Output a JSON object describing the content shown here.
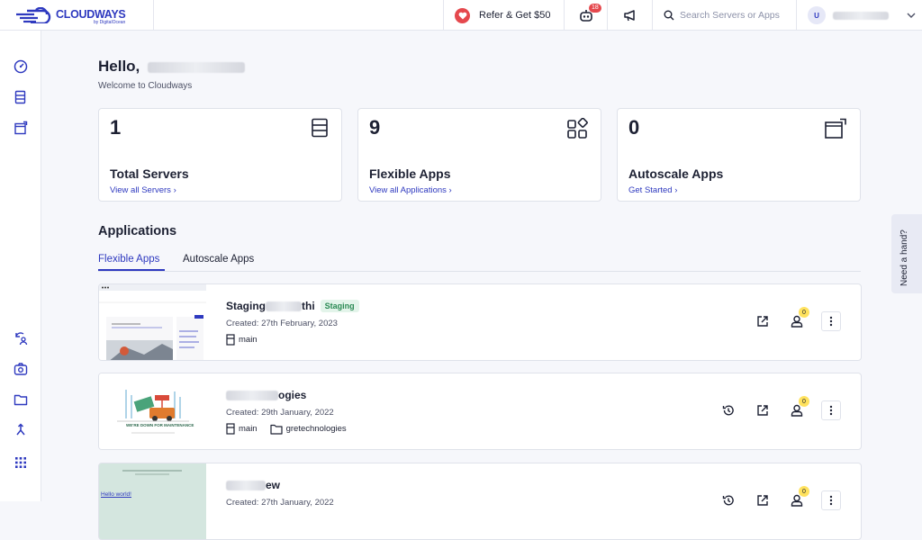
{
  "brand": {
    "name": "CLOUDWAYS",
    "sub": "by DigitalOcean"
  },
  "topbar": {
    "refer_label": "Refer & Get $50",
    "notif_count": "18",
    "search_placeholder": "Search Servers or Apps",
    "user_initial": "U"
  },
  "greeting": {
    "hello": "Hello,",
    "welcome": "Welcome to Cloudways"
  },
  "cards": [
    {
      "number": "1",
      "title": "Total Servers",
      "link": "View all Servers ›"
    },
    {
      "number": "9",
      "title": "Flexible Apps",
      "link": "View all Applications ›"
    },
    {
      "number": "0",
      "title": "Autoscale Apps",
      "link": "Get Started ›"
    }
  ],
  "applications": {
    "heading": "Applications",
    "tabs": [
      {
        "label": "Flexible Apps"
      },
      {
        "label": "Autoscale Apps"
      }
    ],
    "rows": [
      {
        "name_a": "Staging",
        "name_b": "thi",
        "tag": "Staging",
        "created": "Created: 27th February, 2023",
        "branch": "main",
        "folder": "",
        "collab": "0"
      },
      {
        "name_a": "",
        "name_b": "ogies",
        "tag": "",
        "created": "Created: 29th January, 2022",
        "branch": "main",
        "folder": "gretechnologies",
        "collab": "0"
      },
      {
        "name_a": "",
        "name_b": "ew",
        "tag": "",
        "created": "Created: 27th January, 2022",
        "branch": "",
        "folder": "",
        "collab": "0"
      }
    ]
  },
  "help_tab": "Need a hand?",
  "thumbs": {
    "hello_world": "Hello world!",
    "maintenance": "WE'RE DOWN FOR MAINTENANCE",
    "recent_posts": "Recent Posts"
  },
  "colors": {
    "accent": "#2e39bf",
    "danger": "#e5484d",
    "badge": "#ffe25e",
    "tag_green": "#2b8a54"
  }
}
